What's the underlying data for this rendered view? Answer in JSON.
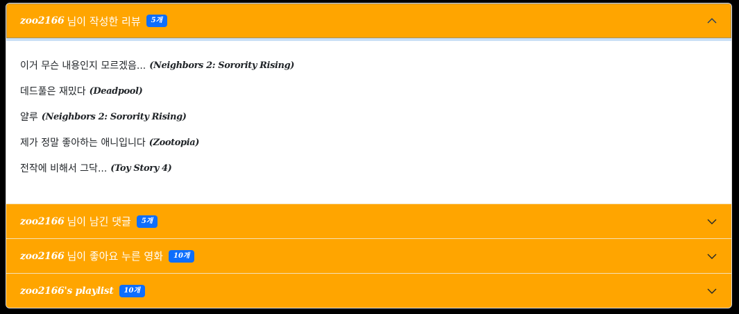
{
  "sections": [
    {
      "username": "zoo2166",
      "title_suffix": "님이 작성한 리뷰",
      "badge": "5개",
      "open": true,
      "reviews": [
        {
          "text": "이거 무슨 내용인지 모르겠음...",
          "movie": "(Neighbors 2: Sorority Rising)"
        },
        {
          "text": "데드풀은 재밌다",
          "movie": "(Deadpool)"
        },
        {
          "text": "얄루",
          "movie": "(Neighbors 2: Sorority Rising)"
        },
        {
          "text": "제가 정말 좋아하는 애니입니다",
          "movie": "(Zootopia)"
        },
        {
          "text": "전작에 비해서 그닥...",
          "movie": "(Toy Story 4)"
        }
      ]
    },
    {
      "username": "zoo2166",
      "title_suffix": "님이 남긴 댓글",
      "badge": "5개",
      "open": false
    },
    {
      "username": "zoo2166",
      "title_suffix": "님이 좋아요 누른 영화",
      "badge": "10개",
      "open": false
    },
    {
      "username": "zoo2166's playlist",
      "title_suffix": "",
      "badge": "10개",
      "open": false
    }
  ],
  "colors": {
    "header_bg": "#ffa500",
    "badge_bg": "#0d6efd",
    "page_bg": "#000000",
    "body_bg": "#ffffff"
  },
  "icons": {
    "open": "chevron-up-icon",
    "closed": "chevron-down-icon"
  }
}
